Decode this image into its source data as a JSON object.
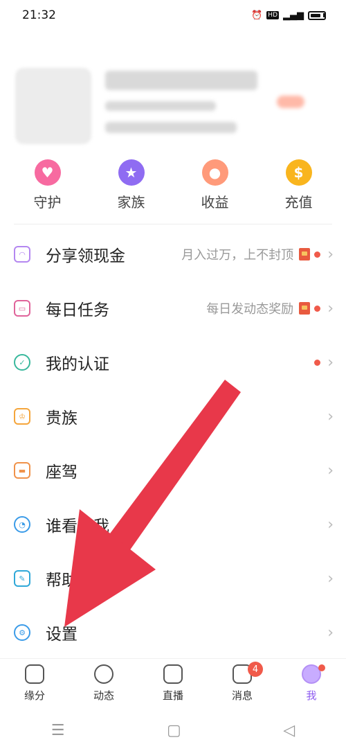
{
  "status": {
    "time": "21:32"
  },
  "quick_actions": [
    {
      "label": "守护",
      "icon": "crown-heart-icon",
      "color": "#f76aa0"
    },
    {
      "label": "家族",
      "icon": "shield-star-icon",
      "color": "#8f6cf2"
    },
    {
      "label": "收益",
      "icon": "piggy-bank-icon",
      "color": "#ff9a7a"
    },
    {
      "label": "充值",
      "icon": "coin-icon",
      "color": "#f9b51e"
    }
  ],
  "menu": [
    {
      "label": "分享领现金",
      "desc": "月入过万，上不封顶",
      "icon": "bag-icon",
      "color": "#b487f0"
    },
    {
      "label": "每日任务",
      "desc": "每日发动态奖励",
      "icon": "task-calendar-icon",
      "color": "#e0639a"
    },
    {
      "label": "我的认证",
      "desc": "",
      "icon": "verified-icon",
      "color": "#38b89c"
    },
    {
      "label": "贵族",
      "desc": "",
      "icon": "crown-icon",
      "color": "#f5a53b"
    },
    {
      "label": "座驾",
      "desc": "",
      "icon": "car-icon",
      "color": "#f0924a"
    },
    {
      "label": "谁看过我",
      "desc": "",
      "icon": "visitor-icon",
      "color": "#3a9be8"
    },
    {
      "label": "帮助与反馈",
      "desc": "",
      "icon": "feedback-icon",
      "color": "#2fa8d8"
    },
    {
      "label": "设置",
      "desc": "",
      "icon": "gear-icon",
      "color": "#3a9be8"
    }
  ],
  "bottom_nav": [
    {
      "label": "缘分"
    },
    {
      "label": "动态"
    },
    {
      "label": "直播"
    },
    {
      "label": "消息",
      "badge": "4"
    },
    {
      "label": "我"
    }
  ],
  "sys_nav": {
    "menu": "☰",
    "home": "▢",
    "back": "◁"
  }
}
